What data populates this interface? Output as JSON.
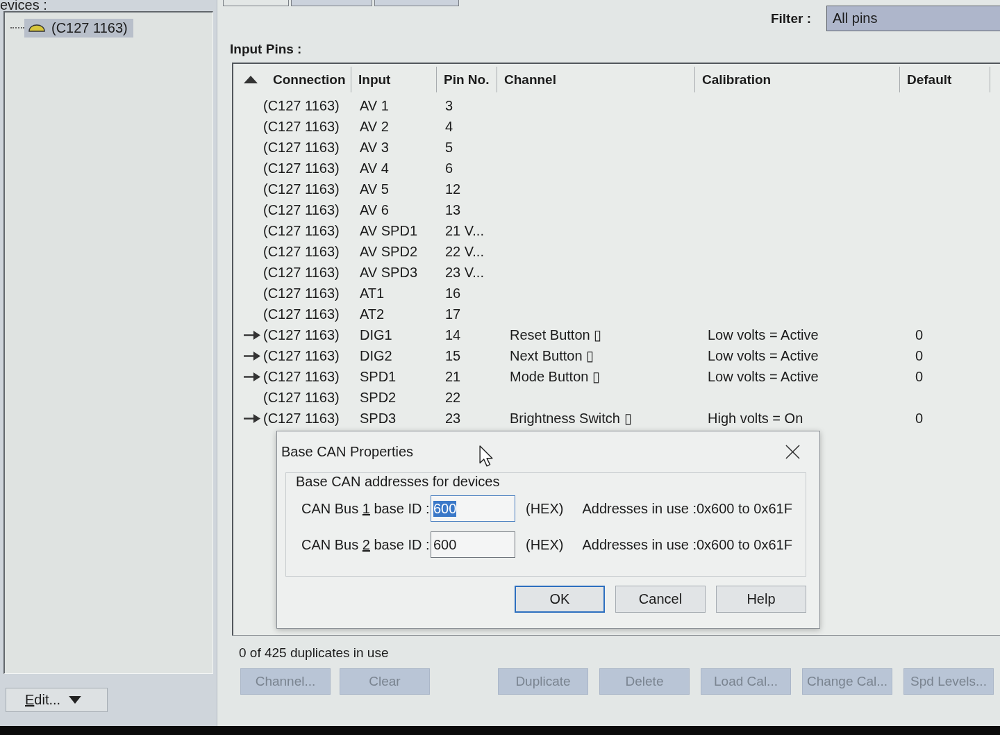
{
  "devices_panel": {
    "label": "evices :",
    "tree": [
      {
        "label": "(C127 1163)",
        "selected": true
      }
    ],
    "edit_button": {
      "mnemonic": "E",
      "rest": "dit..."
    }
  },
  "tabs": [
    {
      "selected": true
    },
    {
      "selected": false
    },
    {
      "selected": false
    }
  ],
  "filter": {
    "label": "Filter :",
    "value": "All pins"
  },
  "input_pins": {
    "label": "Input Pins :",
    "columns": [
      {
        "label": "Connection",
        "sorted": true
      },
      {
        "label": "Input",
        "sorted": false
      },
      {
        "label": "Pin No.",
        "sorted": false
      },
      {
        "label": "Channel",
        "sorted": false
      },
      {
        "label": "Calibration",
        "sorted": false
      },
      {
        "label": "Default",
        "sorted": false
      }
    ],
    "rows": [
      {
        "linked": false,
        "connection": "(C127 1163)",
        "input": "AV 1",
        "pin_no": "3"
      },
      {
        "linked": false,
        "connection": "(C127 1163)",
        "input": "AV 2",
        "pin_no": "4"
      },
      {
        "linked": false,
        "connection": "(C127 1163)",
        "input": "AV 3",
        "pin_no": "5"
      },
      {
        "linked": false,
        "connection": "(C127 1163)",
        "input": "AV 4",
        "pin_no": "6"
      },
      {
        "linked": false,
        "connection": "(C127 1163)",
        "input": "AV 5",
        "pin_no": "12"
      },
      {
        "linked": false,
        "connection": "(C127 1163)",
        "input": "AV 6",
        "pin_no": "13"
      },
      {
        "linked": false,
        "connection": "(C127 1163)",
        "input": "AV SPD1",
        "pin_no": "21 V..."
      },
      {
        "linked": false,
        "connection": "(C127 1163)",
        "input": "AV SPD2",
        "pin_no": "22 V..."
      },
      {
        "linked": false,
        "connection": "(C127 1163)",
        "input": "AV SPD3",
        "pin_no": "23 V..."
      },
      {
        "linked": false,
        "connection": "(C127 1163)",
        "input": "AT1",
        "pin_no": "16"
      },
      {
        "linked": false,
        "connection": "(C127 1163)",
        "input": "AT2",
        "pin_no": "17"
      },
      {
        "linked": true,
        "connection": "(C127 1163)",
        "input": "DIG1",
        "pin_no": "14",
        "channel": "Reset Button ▯",
        "calibration": "Low volts = Active",
        "default": "0"
      },
      {
        "linked": true,
        "connection": "(C127 1163)",
        "input": "DIG2",
        "pin_no": "15",
        "channel": "Next Button ▯",
        "calibration": "Low volts = Active",
        "default": "0"
      },
      {
        "linked": true,
        "connection": "(C127 1163)",
        "input": "SPD1",
        "pin_no": "21",
        "channel": "Mode Button ▯",
        "calibration": "Low volts = Active",
        "default": "0"
      },
      {
        "linked": false,
        "connection": "(C127 1163)",
        "input": "SPD2",
        "pin_no": "22"
      },
      {
        "linked": true,
        "connection": "(C127 1163)",
        "input": "SPD3",
        "pin_no": "23",
        "channel": "Brightness Switch ▯",
        "calibration": "High volts = On",
        "default": "0"
      }
    ]
  },
  "dialog": {
    "title": "Base CAN Properties",
    "group_label": "Base CAN addresses for devices",
    "buses": [
      {
        "label_before": "CAN Bus ",
        "mnemonic": "1",
        "label_after": " base ID :",
        "value": "600",
        "value_selected": true,
        "unit": "(HEX)",
        "range": "Addresses in use :0x600 to 0x61F"
      },
      {
        "label_before": "CAN Bus ",
        "mnemonic": "2",
        "label_after": " base ID :",
        "value": "600",
        "value_selected": false,
        "unit": "(HEX)",
        "range": "Addresses in use :0x600 to 0x61F"
      }
    ],
    "buttons": [
      {
        "label": "OK",
        "default": true
      },
      {
        "label": "Cancel",
        "default": false
      },
      {
        "label": "Help",
        "default": false
      }
    ]
  },
  "status": "0 of 425 duplicates in use",
  "button_groups": [
    [
      {
        "label": "Channel...",
        "disabled": true
      },
      {
        "label": "Clear",
        "disabled": true
      }
    ],
    [
      {
        "label": "Duplicate",
        "disabled": true
      },
      {
        "label": "Delete",
        "disabled": true
      },
      {
        "label": "Load Cal...",
        "disabled": true
      },
      {
        "label": "Change Cal...",
        "disabled": true
      },
      {
        "label": "Spd Levels...",
        "disabled": true
      }
    ]
  ]
}
